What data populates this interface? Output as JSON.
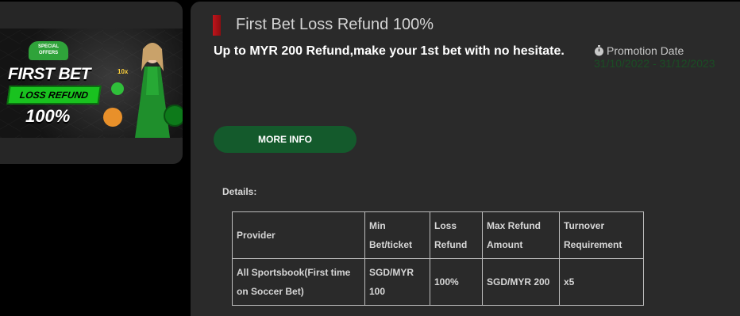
{
  "promo_card": {
    "badge": "SPECIAL OFFERS",
    "title": "FIRST BET",
    "subtitle": "LOSS REFUND",
    "percent": "100%",
    "multiplier": "10x"
  },
  "detail": {
    "title": "First Bet Loss Refund 100%",
    "summary": "Up to MYR 200 Refund,make your 1st bet with no hesitate.",
    "promotion_date_label": "Promotion Date",
    "promotion_date_value": "31/10/2022 - 31/12/2023",
    "more_info_label": "MORE INFO",
    "details_label": "Details:"
  },
  "table": {
    "headers": [
      "Provider",
      "Min Bet/ticket",
      "Loss Refund",
      "Max Refund Amount",
      "Turnover Requirement"
    ],
    "rows": [
      [
        "All Sportsbook(First time on Soccer Bet)",
        "SGD/MYR 100",
        "100%",
        "SGD/MYR 200",
        "x5"
      ]
    ]
  },
  "colors": {
    "accent_red": "#c0141b",
    "button_green": "#145a2c",
    "panel_bg": "#2a2a2a",
    "banner_green": "#19c21f"
  },
  "icons": {
    "date_icon": "stopwatch-icon"
  }
}
